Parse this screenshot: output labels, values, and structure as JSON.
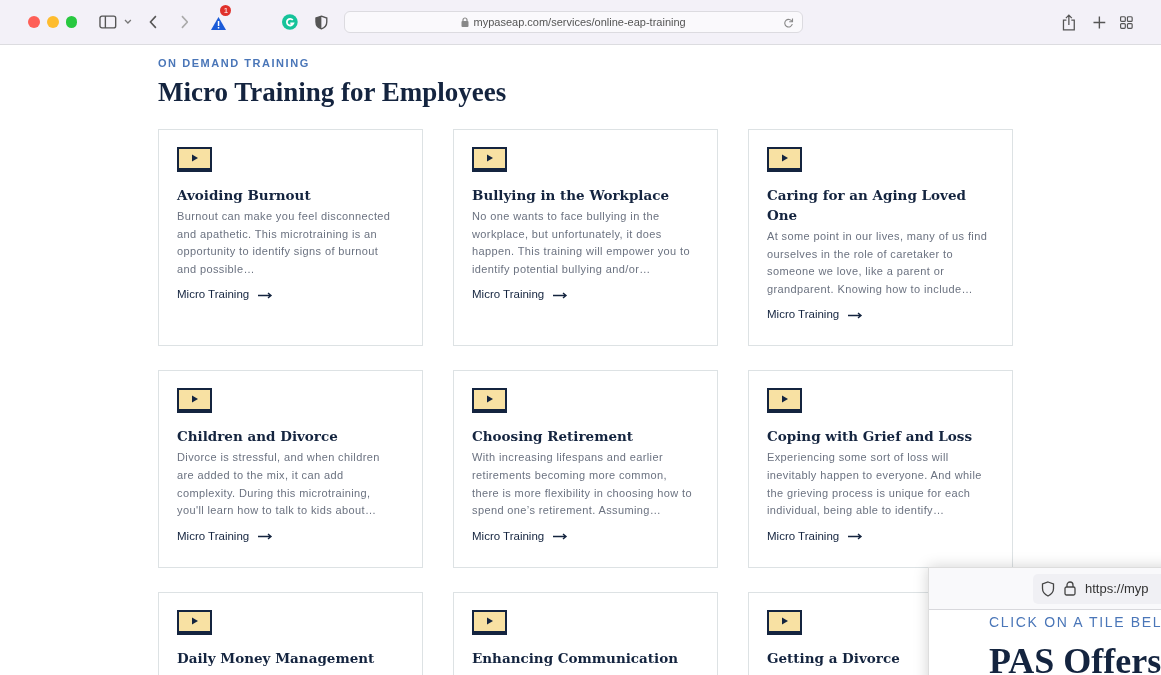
{
  "browser": {
    "url": "mypaseap.com/services/online-eap-training",
    "alert_badge": "1"
  },
  "section": {
    "eyebrow": "ON DEMAND TRAINING",
    "heading": "Micro Training for Employees"
  },
  "cards": [
    {
      "title": "Avoiding Burnout",
      "description": "Burnout can make you feel disconnected and apathetic. This microtraining is an opportunity to identify signs of burnout and possible…",
      "link": "Micro Training"
    },
    {
      "title": "Bullying in the Workplace",
      "description": "No one wants to face bullying in the workplace, but unfortunately, it does happen. This training will empower you to identify potential bullying and/or…",
      "link": "Micro Training"
    },
    {
      "title": "Caring for an Aging Loved One",
      "description": "At some point in our lives, many of us find ourselves in the role of caretaker to someone we love, like a parent or grandparent. Knowing how to include…",
      "link": "Micro Training"
    },
    {
      "title": "Children and Divorce",
      "description": "Divorce is stressful, and when children are added to the mix, it can add complexity. During this microtraining, you'll learn how to talk to kids about…",
      "link": "Micro Training"
    },
    {
      "title": "Choosing Retirement",
      "description": "With increasing lifespans and earlier retirements becoming more common, there is more flexibility in choosing how to spend one’s retirement. Assuming…",
      "link": "Micro Training"
    },
    {
      "title": "Coping with Grief and Loss",
      "description": "Experiencing some sort of loss will inevitably happen to everyone. And while the grieving process is unique for each individual, being able to identify…",
      "link": "Micro Training"
    },
    {
      "title": "Daily Money Management"
    },
    {
      "title": "Enhancing Communication"
    },
    {
      "title": "Getting a Divorce"
    }
  ],
  "overlay_window": {
    "url": "https://myp",
    "eyebrow": "CLICK ON A TILE BEL",
    "heading": "PAS Offers"
  }
}
